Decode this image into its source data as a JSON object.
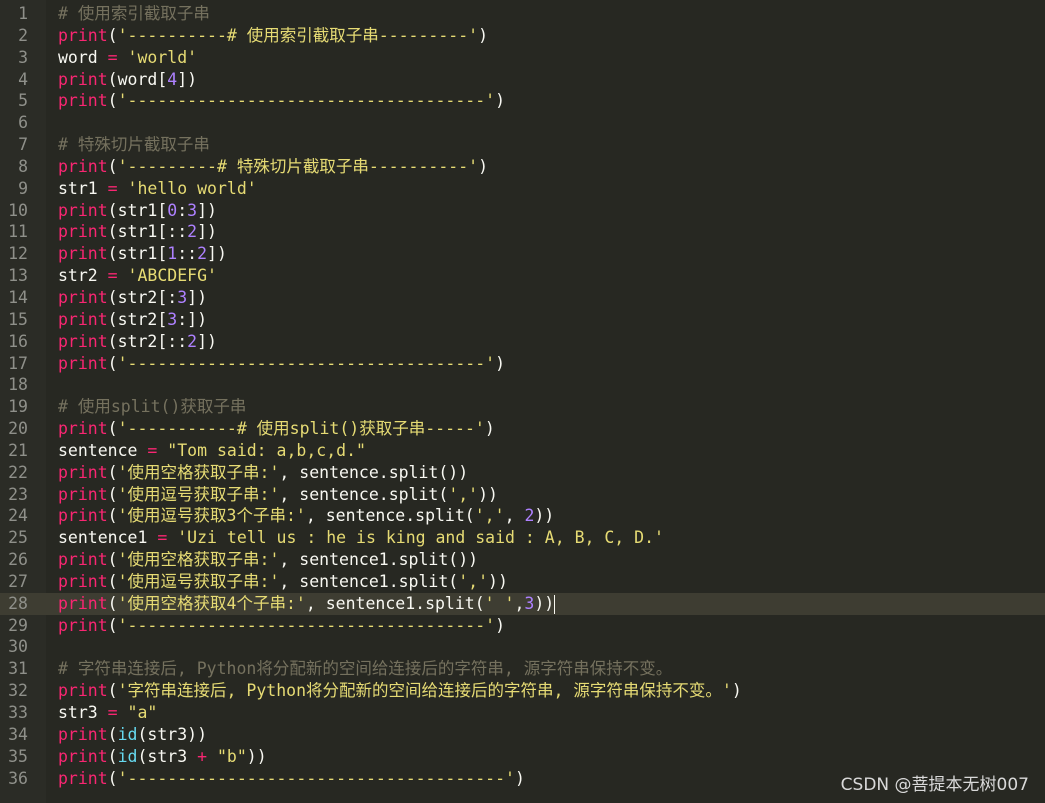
{
  "editor": {
    "current_line": 28,
    "lines": [
      {
        "num": "1",
        "tokens": [
          {
            "t": "# 使用索引截取子串",
            "c": "c"
          }
        ]
      },
      {
        "num": "2",
        "tokens": [
          {
            "t": "print",
            "c": "k"
          },
          {
            "t": "(",
            "c": ""
          },
          {
            "t": "'----------# 使用索引截取子串---------'",
            "c": "s"
          },
          {
            "t": ")",
            "c": ""
          }
        ]
      },
      {
        "num": "3",
        "tokens": [
          {
            "t": "word ",
            "c": ""
          },
          {
            "t": "=",
            "c": "k"
          },
          {
            "t": " ",
            "c": ""
          },
          {
            "t": "'world'",
            "c": "s"
          }
        ]
      },
      {
        "num": "4",
        "tokens": [
          {
            "t": "print",
            "c": "k"
          },
          {
            "t": "(word[",
            "c": ""
          },
          {
            "t": "4",
            "c": "n"
          },
          {
            "t": "])",
            "c": ""
          }
        ]
      },
      {
        "num": "5",
        "tokens": [
          {
            "t": "print",
            "c": "k"
          },
          {
            "t": "(",
            "c": ""
          },
          {
            "t": "'------------------------------------'",
            "c": "s"
          },
          {
            "t": ")",
            "c": ""
          }
        ]
      },
      {
        "num": "6",
        "tokens": []
      },
      {
        "num": "7",
        "tokens": [
          {
            "t": "# 特殊切片截取子串",
            "c": "c"
          }
        ]
      },
      {
        "num": "8",
        "tokens": [
          {
            "t": "print",
            "c": "k"
          },
          {
            "t": "(",
            "c": ""
          },
          {
            "t": "'---------# 特殊切片截取子串----------'",
            "c": "s"
          },
          {
            "t": ")",
            "c": ""
          }
        ]
      },
      {
        "num": "9",
        "tokens": [
          {
            "t": "str1 ",
            "c": ""
          },
          {
            "t": "=",
            "c": "k"
          },
          {
            "t": " ",
            "c": ""
          },
          {
            "t": "'hello world'",
            "c": "s"
          }
        ]
      },
      {
        "num": "10",
        "tokens": [
          {
            "t": "print",
            "c": "k"
          },
          {
            "t": "(str1[",
            "c": ""
          },
          {
            "t": "0",
            "c": "n"
          },
          {
            "t": ":",
            "c": ""
          },
          {
            "t": "3",
            "c": "n"
          },
          {
            "t": "])",
            "c": ""
          }
        ]
      },
      {
        "num": "11",
        "tokens": [
          {
            "t": "print",
            "c": "k"
          },
          {
            "t": "(str1[::",
            "c": ""
          },
          {
            "t": "2",
            "c": "n"
          },
          {
            "t": "])",
            "c": ""
          }
        ]
      },
      {
        "num": "12",
        "tokens": [
          {
            "t": "print",
            "c": "k"
          },
          {
            "t": "(str1[",
            "c": ""
          },
          {
            "t": "1",
            "c": "n"
          },
          {
            "t": "::",
            "c": ""
          },
          {
            "t": "2",
            "c": "n"
          },
          {
            "t": "])",
            "c": ""
          }
        ]
      },
      {
        "num": "13",
        "tokens": [
          {
            "t": "str2 ",
            "c": ""
          },
          {
            "t": "=",
            "c": "k"
          },
          {
            "t": " ",
            "c": ""
          },
          {
            "t": "'ABCDEFG'",
            "c": "s"
          }
        ]
      },
      {
        "num": "14",
        "tokens": [
          {
            "t": "print",
            "c": "k"
          },
          {
            "t": "(str2[:",
            "c": ""
          },
          {
            "t": "3",
            "c": "n"
          },
          {
            "t": "])",
            "c": ""
          }
        ]
      },
      {
        "num": "15",
        "tokens": [
          {
            "t": "print",
            "c": "k"
          },
          {
            "t": "(str2[",
            "c": ""
          },
          {
            "t": "3",
            "c": "n"
          },
          {
            "t": ":])",
            "c": ""
          }
        ]
      },
      {
        "num": "16",
        "tokens": [
          {
            "t": "print",
            "c": "k"
          },
          {
            "t": "(str2[::",
            "c": ""
          },
          {
            "t": "2",
            "c": "n"
          },
          {
            "t": "])",
            "c": ""
          }
        ]
      },
      {
        "num": "17",
        "tokens": [
          {
            "t": "print",
            "c": "k"
          },
          {
            "t": "(",
            "c": ""
          },
          {
            "t": "'------------------------------------'",
            "c": "s"
          },
          {
            "t": ")",
            "c": ""
          }
        ]
      },
      {
        "num": "18",
        "tokens": []
      },
      {
        "num": "19",
        "tokens": [
          {
            "t": "# 使用split()获取子串",
            "c": "c"
          }
        ]
      },
      {
        "num": "20",
        "tokens": [
          {
            "t": "print",
            "c": "k"
          },
          {
            "t": "(",
            "c": ""
          },
          {
            "t": "'-----------# 使用split()获取子串-----'",
            "c": "s"
          },
          {
            "t": ")",
            "c": ""
          }
        ]
      },
      {
        "num": "21",
        "tokens": [
          {
            "t": "sentence ",
            "c": ""
          },
          {
            "t": "=",
            "c": "k"
          },
          {
            "t": " ",
            "c": ""
          },
          {
            "t": "\"Tom said: a,b,c,d.\"",
            "c": "s"
          }
        ]
      },
      {
        "num": "22",
        "tokens": [
          {
            "t": "print",
            "c": "k"
          },
          {
            "t": "(",
            "c": ""
          },
          {
            "t": "'使用空格获取子串:'",
            "c": "s"
          },
          {
            "t": ", sentence.split())",
            "c": ""
          }
        ]
      },
      {
        "num": "23",
        "tokens": [
          {
            "t": "print",
            "c": "k"
          },
          {
            "t": "(",
            "c": ""
          },
          {
            "t": "'使用逗号获取子串:'",
            "c": "s"
          },
          {
            "t": ", sentence.split(",
            "c": ""
          },
          {
            "t": "','",
            "c": "s"
          },
          {
            "t": "))",
            "c": ""
          }
        ]
      },
      {
        "num": "24",
        "tokens": [
          {
            "t": "print",
            "c": "k"
          },
          {
            "t": "(",
            "c": ""
          },
          {
            "t": "'使用逗号获取3个子串:'",
            "c": "s"
          },
          {
            "t": ", sentence.split(",
            "c": ""
          },
          {
            "t": "','",
            "c": "s"
          },
          {
            "t": ", ",
            "c": ""
          },
          {
            "t": "2",
            "c": "n"
          },
          {
            "t": "))",
            "c": ""
          }
        ]
      },
      {
        "num": "25",
        "tokens": [
          {
            "t": "sentence1 ",
            "c": ""
          },
          {
            "t": "=",
            "c": "k"
          },
          {
            "t": " ",
            "c": ""
          },
          {
            "t": "'Uzi tell us : he is king and said : A, B, C, D.'",
            "c": "s"
          }
        ]
      },
      {
        "num": "26",
        "tokens": [
          {
            "t": "print",
            "c": "k"
          },
          {
            "t": "(",
            "c": ""
          },
          {
            "t": "'使用空格获取子串:'",
            "c": "s"
          },
          {
            "t": ", sentence1.split())",
            "c": ""
          }
        ]
      },
      {
        "num": "27",
        "tokens": [
          {
            "t": "print",
            "c": "k"
          },
          {
            "t": "(",
            "c": ""
          },
          {
            "t": "'使用逗号获取子串:'",
            "c": "s"
          },
          {
            "t": ", sentence1.split(",
            "c": ""
          },
          {
            "t": "','",
            "c": "s"
          },
          {
            "t": "))",
            "c": ""
          }
        ]
      },
      {
        "num": "28",
        "tokens": [
          {
            "t": "print",
            "c": "k"
          },
          {
            "t": "(",
            "c": ""
          },
          {
            "t": "'使用空格获取4个子串:'",
            "c": "s"
          },
          {
            "t": ", sentence1.split(",
            "c": ""
          },
          {
            "t": "' '",
            "c": "s"
          },
          {
            "t": ",",
            "c": ""
          },
          {
            "t": "3",
            "c": "n"
          },
          {
            "t": "))",
            "c": ""
          }
        ]
      },
      {
        "num": "29",
        "tokens": [
          {
            "t": "print",
            "c": "k"
          },
          {
            "t": "(",
            "c": ""
          },
          {
            "t": "'------------------------------------'",
            "c": "s"
          },
          {
            "t": ")",
            "c": ""
          }
        ]
      },
      {
        "num": "30",
        "tokens": []
      },
      {
        "num": "31",
        "tokens": [
          {
            "t": "# 字符串连接后, Python将分配新的空间给连接后的字符串, 源字符串保持不变。",
            "c": "c"
          }
        ]
      },
      {
        "num": "32",
        "tokens": [
          {
            "t": "print",
            "c": "k"
          },
          {
            "t": "(",
            "c": ""
          },
          {
            "t": "'字符串连接后, Python将分配新的空间给连接后的字符串, 源字符串保持不变。'",
            "c": "s"
          },
          {
            "t": ")",
            "c": ""
          }
        ]
      },
      {
        "num": "33",
        "tokens": [
          {
            "t": "str3 ",
            "c": ""
          },
          {
            "t": "=",
            "c": "k"
          },
          {
            "t": " ",
            "c": ""
          },
          {
            "t": "\"a\"",
            "c": "s"
          }
        ]
      },
      {
        "num": "34",
        "tokens": [
          {
            "t": "print",
            "c": "k"
          },
          {
            "t": "(",
            "c": ""
          },
          {
            "t": "id",
            "c": "f"
          },
          {
            "t": "(str3))",
            "c": ""
          }
        ]
      },
      {
        "num": "35",
        "tokens": [
          {
            "t": "print",
            "c": "k"
          },
          {
            "t": "(",
            "c": ""
          },
          {
            "t": "id",
            "c": "f"
          },
          {
            "t": "(str3 ",
            "c": ""
          },
          {
            "t": "+",
            "c": "k"
          },
          {
            "t": " ",
            "c": ""
          },
          {
            "t": "\"b\"",
            "c": "s"
          },
          {
            "t": "))",
            "c": ""
          }
        ]
      },
      {
        "num": "36",
        "tokens": [
          {
            "t": "print",
            "c": "k"
          },
          {
            "t": "(",
            "c": ""
          },
          {
            "t": "'--------------------------------------'",
            "c": "s"
          },
          {
            "t": ")",
            "c": ""
          }
        ]
      }
    ]
  },
  "watermark": "CSDN @菩提本无树007",
  "colors": {
    "background": "#272822",
    "keyword": "#f92672",
    "string": "#e6db74",
    "comment": "#75715e",
    "number": "#ae81ff",
    "builtin": "#66d9ef",
    "text": "#f8f8f2",
    "line_number": "#8f908a",
    "current_line": "#3e3d32"
  }
}
